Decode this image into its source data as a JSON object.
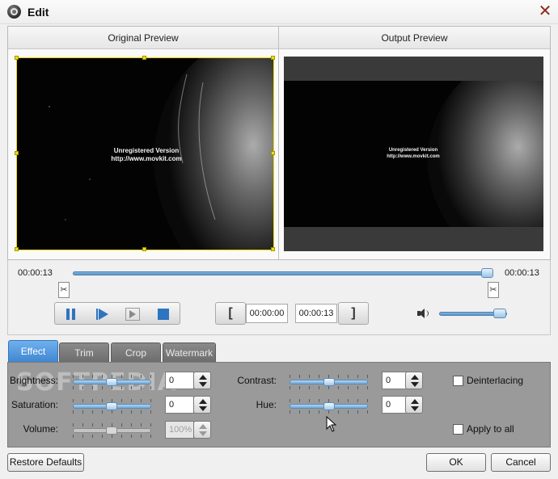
{
  "window": {
    "title": "Edit"
  },
  "preview": {
    "original_label": "Original Preview",
    "output_label": "Output Preview",
    "watermark_line1": "Unregistered Version",
    "watermark_line2": "http://www.movkit.com"
  },
  "timeline": {
    "start_time": "00:00:13",
    "end_time": "00:00:13",
    "position_fraction": 1.0,
    "clip_start": "00:00:00",
    "clip_end": "00:00:13",
    "volume_fraction": 0.9
  },
  "tabs": [
    {
      "label": "Effect",
      "active": true
    },
    {
      "label": "Trim"
    },
    {
      "label": "Crop"
    },
    {
      "label": "Watermark"
    }
  ],
  "effect": {
    "brightness": {
      "label": "Brightness:",
      "value": "0"
    },
    "saturation": {
      "label": "Saturation:",
      "value": "0"
    },
    "volume": {
      "label": "Volume:",
      "value": "100%"
    },
    "contrast": {
      "label": "Contrast:",
      "value": "0"
    },
    "hue": {
      "label": "Hue:",
      "value": "0"
    },
    "deinterlacing_label": "Deinterlacing",
    "apply_all_label": "Apply to all"
  },
  "footer": {
    "restore_label": "Restore Defaults",
    "ok_label": "OK",
    "cancel_label": "Cancel"
  },
  "watermark_overlay": "SOFTPEDIA",
  "colors": {
    "accent": "#3f86d0",
    "panel": "#9a9a9a",
    "crop_frame": "#e8d800"
  }
}
